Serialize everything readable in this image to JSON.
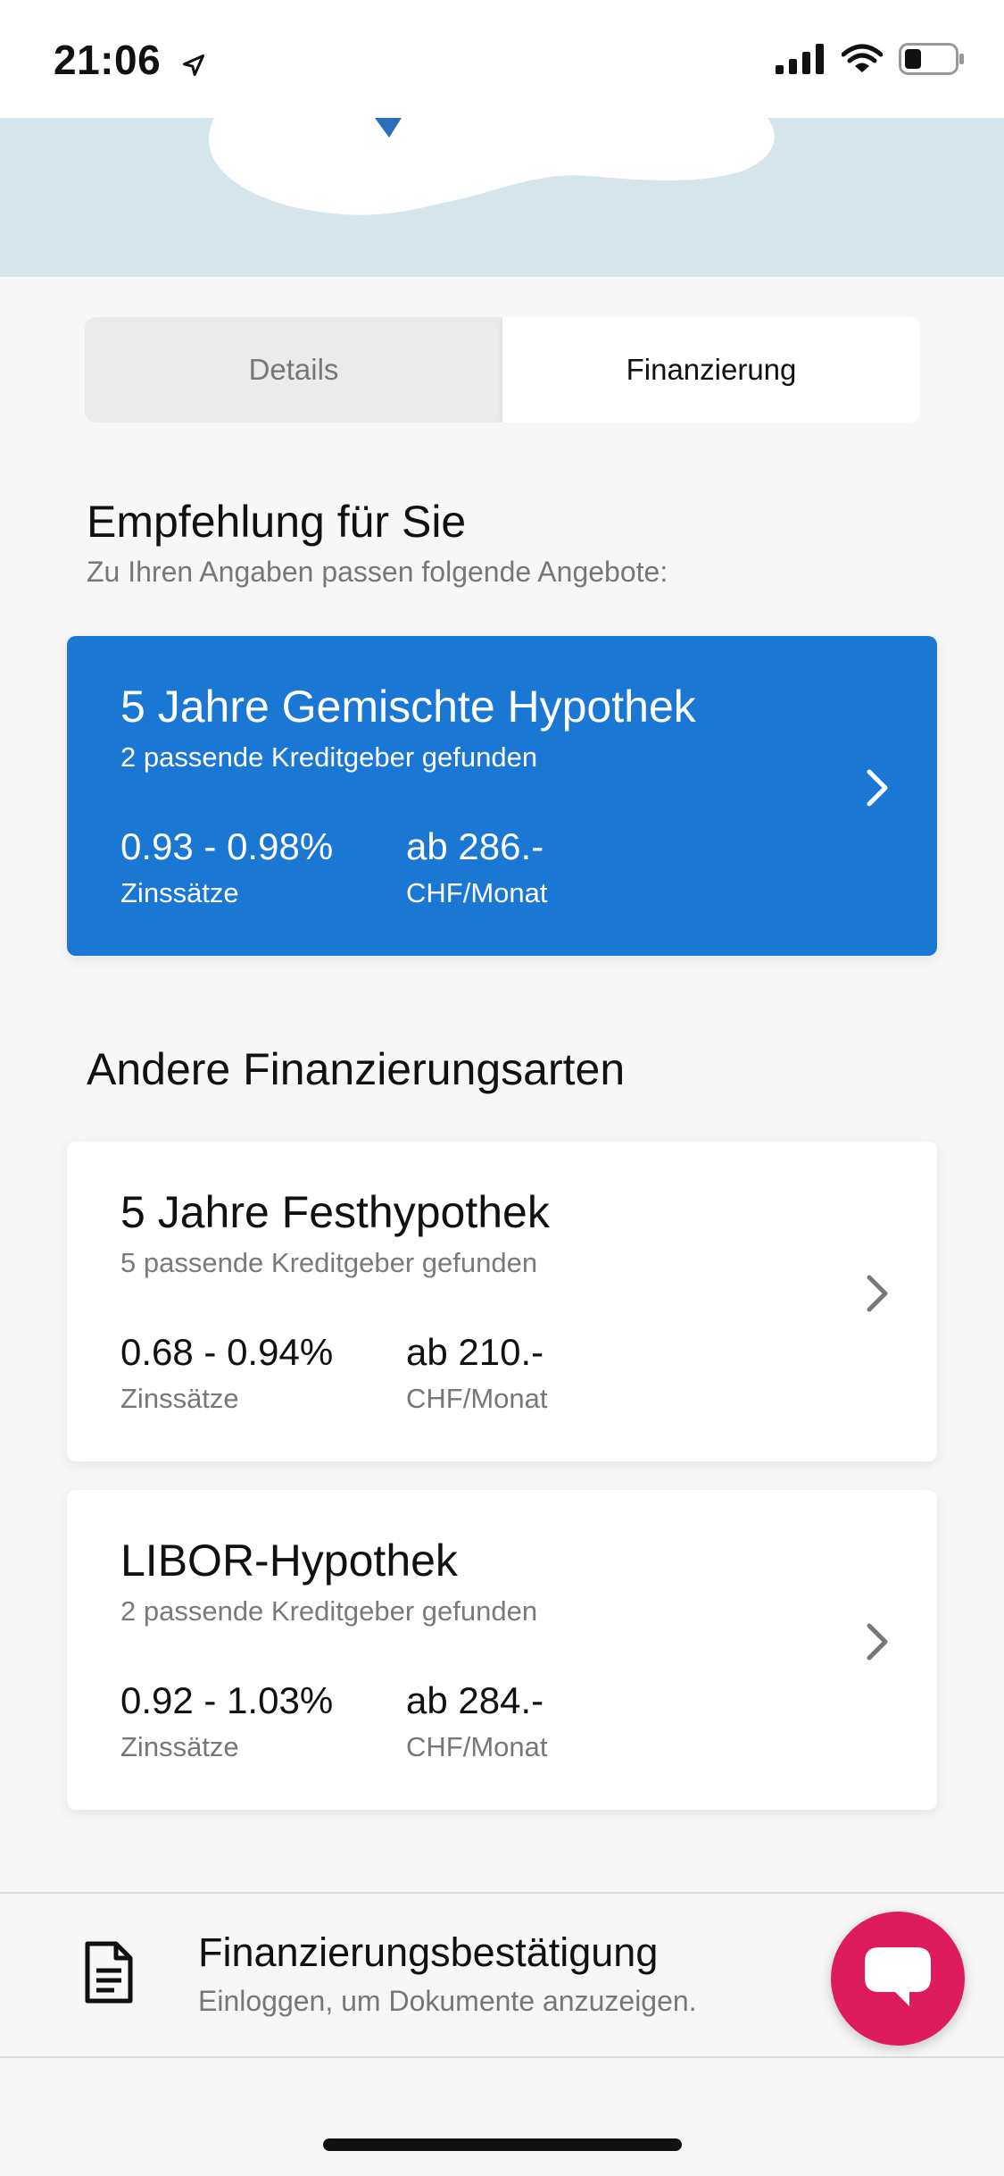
{
  "status_bar": {
    "time": "21:06"
  },
  "tabs": {
    "details": "Details",
    "financing": "Finanzierung",
    "active": "Finanzierung"
  },
  "recommendation": {
    "heading": "Empfehlung für Sie",
    "subheading": "Zu Ihren Angaben passen folgende Angebote:",
    "card": {
      "title": "5 Jahre Gemischte Hypothek",
      "subtitle": "2 passende Kreditgeber gefunden",
      "rate": "0.93 - 0.98%",
      "rate_label": "Zinssätze",
      "price": "ab 286.-",
      "price_label": "CHF/Monat"
    }
  },
  "other": {
    "heading": "Andere Finanzierungsarten",
    "cards": [
      {
        "title": "5 Jahre Festhypothek",
        "subtitle": "5 passende Kreditgeber gefunden",
        "rate": "0.68 - 0.94%",
        "rate_label": "Zinssätze",
        "price": "ab 210.-",
        "price_label": "CHF/Monat"
      },
      {
        "title": "LIBOR-Hypothek",
        "subtitle": "2 passende Kreditgeber gefunden",
        "rate": "0.92 - 1.03%",
        "rate_label": "Zinssätze",
        "price": "ab 284.-",
        "price_label": "CHF/Monat"
      }
    ]
  },
  "document": {
    "title": "Finanzierungsbestätigung",
    "subtitle": "Einloggen, um Dokumente anzuzeigen."
  },
  "colors": {
    "accent_blue": "#1a77d4",
    "chat_pink": "#de1b5d",
    "hero_bg": "#d6e4ec"
  },
  "icons": [
    "location-arrow-icon",
    "signal-icon",
    "wifi-icon",
    "battery-icon",
    "chevron-right-icon",
    "document-icon",
    "chat-icon"
  ]
}
